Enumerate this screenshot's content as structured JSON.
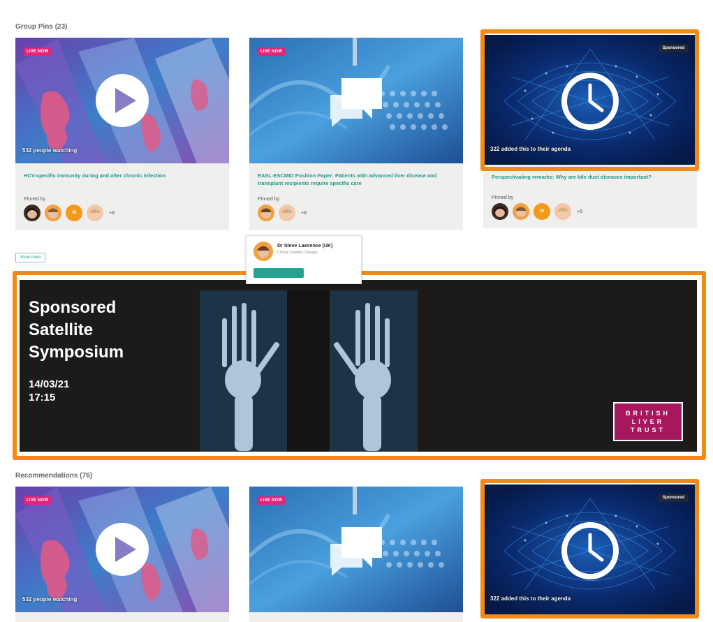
{
  "group_pins": {
    "label": "Group Pins",
    "count": "(23)",
    "cards": [
      {
        "badge": "LIVE NOW",
        "caption": "532 people watching",
        "title": "HCV-specific immunity during and after chronic infection",
        "pinned_label": "Pinned by",
        "count_badge": "30",
        "more": "+8"
      },
      {
        "badge": "LIVE NOW",
        "title": "EASL-ESCMID Position Paper: Patients with advanced liver disease and transplant recipients require specific care",
        "pinned_label": "Pinned by",
        "more": "+8"
      },
      {
        "badge": "Sponsored",
        "caption": "322 added this to their agenda",
        "title": "Perspectivating remarks: Why are bile duct diseases important?",
        "pinned_label": "Pinned by",
        "count_badge": "30",
        "more": "+8"
      }
    ],
    "show_more": "show more"
  },
  "tooltip": {
    "name": "Dr Steve Lawrence (UK)",
    "role": "Clinical Scientist, Chicago"
  },
  "banner": {
    "title": "Sponsored Satellite Symposium",
    "date": "14/03/21",
    "time": "17:15",
    "logo_lines": [
      "BRITISH",
      "LIVER",
      "TRUST"
    ]
  },
  "recommendations": {
    "label": "Recommendations",
    "count": "(76)",
    "cards": [
      {
        "badge": "LIVE NOW",
        "caption": "532 people watching"
      },
      {
        "badge": "LIVE NOW"
      },
      {
        "badge": "Sponsored",
        "caption": "322 added this to their agenda"
      }
    ]
  },
  "colors": {
    "highlight": "#f28a16",
    "live_badge": "#e0257a",
    "link_teal": "#1b9b8a",
    "banner_bg": "#1c1b19",
    "logo_bg": "#a6175d"
  },
  "icons": [
    "play-icon",
    "chat-bubbles-icon",
    "clock-icon"
  ]
}
